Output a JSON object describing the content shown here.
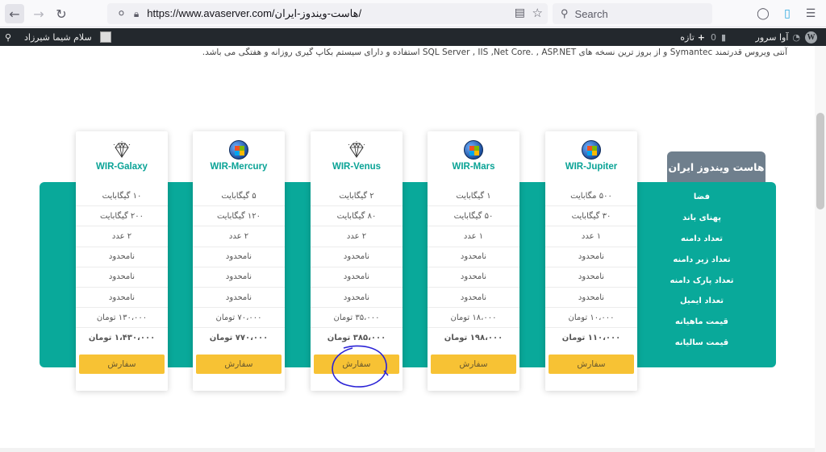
{
  "browser": {
    "url": "https://www.avaserver.com/هاست-ویندوز-ایران/",
    "search_placeholder": "Search"
  },
  "adminbar": {
    "site_name": "آوا سرور",
    "comments_count": "0",
    "new_label": "تازه",
    "greeting": "سلام شیما شیرزاد"
  },
  "intro_text": "آنتی ویروس قدرتمند Symantec و از بروز ترین نسخه های SQL Server , IIS ,Net Core. , ASP.NET استفاده و دارای سیستم بکاپ گیری روزانه و هفتگی می باشد.",
  "section": {
    "title": "هاست ویندوز ایران",
    "labels": [
      "فضا",
      "پهنای باند",
      "تعداد دامنه",
      "تعداد زیر دامنه",
      "تعداد پارک دامنه",
      "تعداد ایمیل",
      "قیمت ماهیانه",
      "قیمت سالیانه"
    ]
  },
  "order_label": "سفارش",
  "plans": [
    {
      "name": "WIR-Jupiter",
      "icon": "windows-globe-icon",
      "values": [
        "۵۰۰ مگابایت",
        "۳۰ گیگابایت",
        "۱ عدد",
        "نامحدود",
        "نامحدود",
        "نامحدود",
        "۱۰،۰۰۰ تومان",
        "۱۱۰،۰۰۰ تومان"
      ]
    },
    {
      "name": "WIR-Mars",
      "icon": "windows-globe-icon",
      "values": [
        "۱ گیگابایت",
        "۵۰ گیگابایت",
        "۱ عدد",
        "نامحدود",
        "نامحدود",
        "نامحدود",
        "۱۸،۰۰۰ تومان",
        "۱۹۸،۰۰۰ تومان"
      ]
    },
    {
      "name": "WIR-Venus",
      "icon": "diamond-icon",
      "values": [
        "۲ گیگابایت",
        "۸۰ گیگابایت",
        "۲ عدد",
        "نامحدود",
        "نامحدود",
        "نامحدود",
        "۳۵،۰۰۰ تومان",
        "۳۸۵،۰۰۰ تومان"
      ]
    },
    {
      "name": "WIR-Mercury",
      "icon": "windows-globe-icon",
      "values": [
        "۵ گیگابایت",
        "۱۲۰ گیگابایت",
        "۲ عدد",
        "نامحدود",
        "نامحدود",
        "نامحدود",
        "۷۰،۰۰۰ تومان",
        "۷۷۰،۰۰۰ تومان"
      ]
    },
    {
      "name": "WIR-Galaxy",
      "icon": "diamond-icon",
      "values": [
        "۱۰ گیگابایت",
        "۲۰۰ گیگابایت",
        "۲ عدد",
        "نامحدود",
        "نامحدود",
        "نامحدود",
        "۱۳۰،۰۰۰ تومان",
        "۱،۴۳۰،۰۰۰ تومان"
      ]
    }
  ],
  "colors": {
    "teal": "#09a99a",
    "tag": "#6f7f8d",
    "button": "#f7c234",
    "annotation": "#2a22d6"
  }
}
